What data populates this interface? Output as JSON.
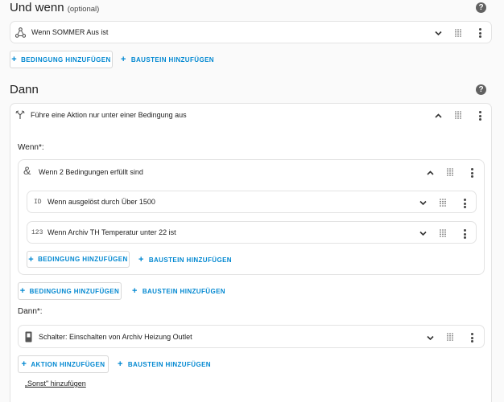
{
  "section1": {
    "title": "Und wenn",
    "subtitle": "(optional)",
    "row": {
      "text": "Wenn SOMMER Aus ist",
      "icon": "graph-nodes-icon"
    },
    "add_condition": "BEDINGUNG HINZUFÜGEN",
    "add_block": "BAUSTEIN HINZUFÜGEN"
  },
  "section2": {
    "title": "Dann",
    "action_card": {
      "title": "Führe eine Aktion nur unter einer Bedingung aus",
      "icon": "branch-icon",
      "if_label": "Wenn*:",
      "and_card": {
        "title": "Wenn 2 Bedingungen erfüllt sind",
        "icon": "ampersand-icon",
        "rows": [
          {
            "icon": "ID",
            "text": "Wenn ausgelöst durch Über 1500"
          },
          {
            "icon": "123",
            "text": "Wenn Archiv TH Temperatur unter 22 ist"
          }
        ],
        "add_condition": "BEDINGUNG HINZUFÜGEN",
        "add_block": "BAUSTEIN HINZUFÜGEN"
      },
      "add_condition": "BEDINGUNG HINZUFÜGEN",
      "add_block": "BAUSTEIN HINZUFÜGEN",
      "then_label": "Dann*:",
      "then_row": {
        "text": "Schalter: Einschalten von Archiv Heizung Outlet",
        "icon": "switch-icon"
      },
      "add_action": "AKTION HINZUFÜGEN",
      "add_block2": "BAUSTEIN HINZUFÜGEN",
      "else_link": "„Sonst\" hinzufügen"
    }
  },
  "colors": {
    "accent": "#0288d1",
    "text": "#212121",
    "background": "#fafafa"
  }
}
